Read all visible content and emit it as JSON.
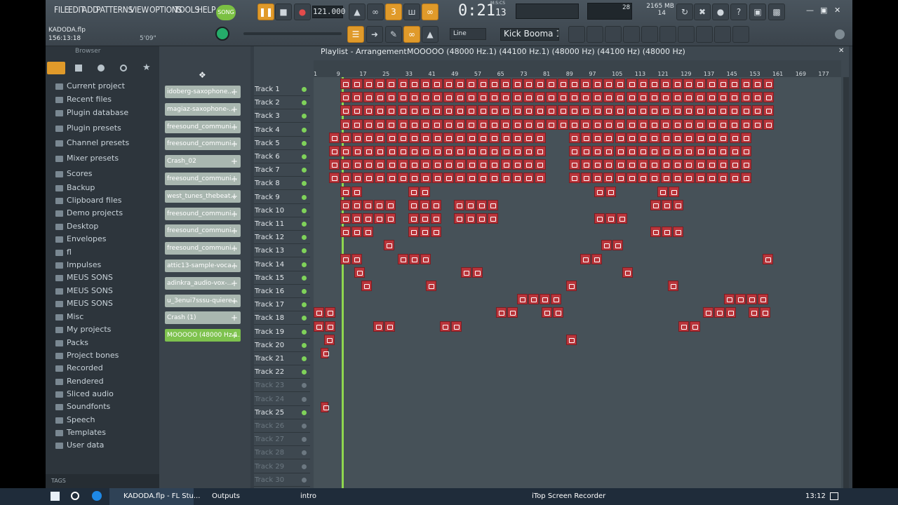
{
  "menus": [
    "FILE",
    "EDIT",
    "ADD",
    "PATTERNS",
    "VIEW",
    "OPTIONS",
    "TOOLS",
    "HELP"
  ],
  "transport": {
    "song_label": "SONG",
    "tempo": "121.000",
    "time": "0:21",
    "time_sub": "13",
    "time_unit": "M:S:CS"
  },
  "meters": {
    "cpu": "28",
    "mem": "2165 MB",
    "voices": "14"
  },
  "project": {
    "file": "KADODA.flp",
    "time": "156:13:18",
    "length": "5'09\""
  },
  "tool": {
    "snap": "Line",
    "instrument": "Kick Booma 1"
  },
  "playlist": {
    "title": "Playlist - Arrangement",
    "pattern": "MOOOOO (48000 Hz.1) (44100 Hz.1) (48000 Hz) (44100 Hz) (48000 Hz)"
  },
  "ruler": [
    "1",
    "9",
    "17",
    "25",
    "33",
    "41",
    "49",
    "57",
    "65",
    "73",
    "81",
    "89",
    "97",
    "105",
    "113",
    "121",
    "129",
    "137",
    "145",
    "153",
    "161",
    "169",
    "177"
  ],
  "browser": {
    "title": "Browser",
    "items": [
      "Current project",
      "Recent files",
      "Plugin database",
      "Plugin presets",
      "Channel presets",
      "Mixer presets",
      "Scores",
      "Backup",
      "Clipboard files",
      "Demo projects",
      "Desktop",
      "Envelopes",
      "fl",
      "Impulses",
      "MEUS SONS",
      "MEUS SONS",
      "MEUS SONS",
      "Misc",
      "My projects",
      "Packs",
      "Project bones",
      "Recorded",
      "Rendered",
      "Sliced audio",
      "Soundfonts",
      "Speech",
      "Templates",
      "User data"
    ],
    "tags": "TAGS"
  },
  "channels": [
    "idoberg-saxophone...",
    "magiaz-saxophone-...",
    "freesound_communi...",
    "freesound_communi...",
    "Crash_02",
    "freesound_communi...",
    "west_tunes_thebeat...",
    "freesound_communi...",
    "freesound_communi...",
    "freesound_communi...",
    "attic13-sample-voca...",
    "adinkra_audio-vox-...",
    "u_3enui7sssu-quiere...",
    "Crash (1)",
    "MOOOOO (48000 Hz.1..."
  ],
  "tracks": [
    "Track 1",
    "Track 2",
    "Track 3",
    "Track 4",
    "Track 5",
    "Track 6",
    "Track 7",
    "Track 8",
    "Track 9",
    "Track 10",
    "Track 11",
    "Track 12",
    "Track 13",
    "Track 14",
    "Track 15",
    "Track 16",
    "Track 17",
    "Track 18",
    "Track 19",
    "Track 20",
    "Track 21",
    "Track 22",
    "Track 23",
    "Track 24",
    "Track 25",
    "Track 26",
    "Track 27",
    "Track 28",
    "Track 29",
    "Track 30"
  ],
  "taskbar": {
    "items": [
      "KADODA.flp - FL Stu...",
      "Outputs",
      "intro",
      "iTop Screen Recorder"
    ],
    "clock": "13:12"
  },
  "colors": {
    "clip": "#b9343a",
    "accent": "#e09a2a",
    "playhead": "#8fd64f"
  }
}
